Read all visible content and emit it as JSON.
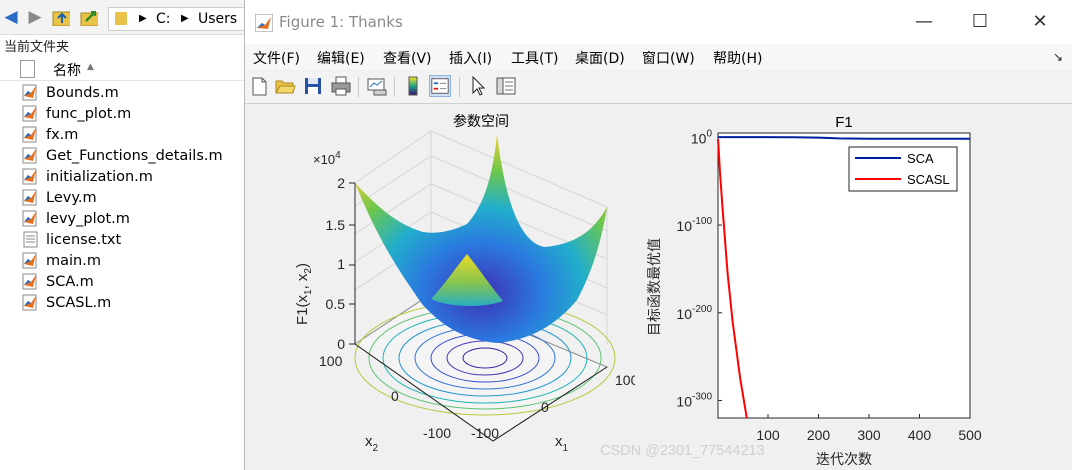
{
  "browser": {
    "address": {
      "drive": "C:",
      "folder": "Users"
    },
    "current_folder_label": "当前文件夹",
    "column_name": "名称",
    "files": [
      {
        "name": "Bounds.m",
        "type": "m"
      },
      {
        "name": "func_plot.m",
        "type": "m"
      },
      {
        "name": "fx.m",
        "type": "m"
      },
      {
        "name": "Get_Functions_details.m",
        "type": "m"
      },
      {
        "name": "initialization.m",
        "type": "m"
      },
      {
        "name": "Levy.m",
        "type": "m"
      },
      {
        "name": "levy_plot.m",
        "type": "m"
      },
      {
        "name": "license.txt",
        "type": "txt"
      },
      {
        "name": "main.m",
        "type": "m"
      },
      {
        "name": "SCA.m",
        "type": "m"
      },
      {
        "name": "SCASL.m",
        "type": "m"
      }
    ]
  },
  "figure": {
    "title": "Figure 1: Thanks",
    "menus": [
      "文件(F)",
      "编辑(E)",
      "查看(V)",
      "插入(I)",
      "工具(T)",
      "桌面(D)",
      "窗口(W)",
      "帮助(H)"
    ],
    "toolbar_icons": [
      "new-figure-icon",
      "open-file-icon",
      "save-icon",
      "print-icon",
      "link-plot-icon",
      "colorbar-icon",
      "legend-icon",
      "pointer-icon",
      "property-inspector-icon"
    ]
  },
  "surface_plot": {
    "title": "参数空间",
    "zlabel": "F1(x1, x2)",
    "xlabel": "x1",
    "ylabel": "x2",
    "z_exponent": "×10^4",
    "z_ticks": [
      "2",
      "1.5",
      "1",
      "0.5",
      "0"
    ],
    "x1_ticks": [
      "-100",
      "0",
      "100"
    ],
    "x2_ticks": [
      "100",
      "0",
      "-100"
    ]
  },
  "chart_data": {
    "type": "line",
    "title": "F1",
    "xlabel": "迭代次数",
    "ylabel": "目标函数最优值",
    "y_scale": "log",
    "xlim": [
      1,
      500
    ],
    "ylim_exponent": [
      -320,
      5
    ],
    "x_ticks": [
      100,
      200,
      300,
      400,
      500
    ],
    "y_ticks": [
      {
        "base": "10",
        "exp": "0"
      },
      {
        "base": "10",
        "exp": "-100"
      },
      {
        "base": "10",
        "exp": "-200"
      },
      {
        "base": "10",
        "exp": "-300"
      }
    ],
    "legend_position": "top-right",
    "series": [
      {
        "name": "SCA",
        "color": "#00209f",
        "log10_values": [
          [
            1,
            0.3
          ],
          [
            50,
            0.3
          ],
          [
            150,
            0.25
          ],
          [
            200,
            -0.3
          ],
          [
            240,
            -1.2
          ],
          [
            300,
            -1.5
          ],
          [
            400,
            -1.6
          ],
          [
            500,
            -1.6
          ]
        ]
      },
      {
        "name": "SCASL",
        "color": "#ff0000",
        "log10_values": [
          [
            1,
            -2
          ],
          [
            2,
            -10
          ],
          [
            5,
            -40
          ],
          [
            10,
            -80
          ],
          [
            20,
            -155
          ],
          [
            30,
            -210
          ],
          [
            45,
            -275
          ],
          [
            58,
            -320
          ]
        ]
      }
    ]
  },
  "watermark": "CSDN @2301_77544213"
}
